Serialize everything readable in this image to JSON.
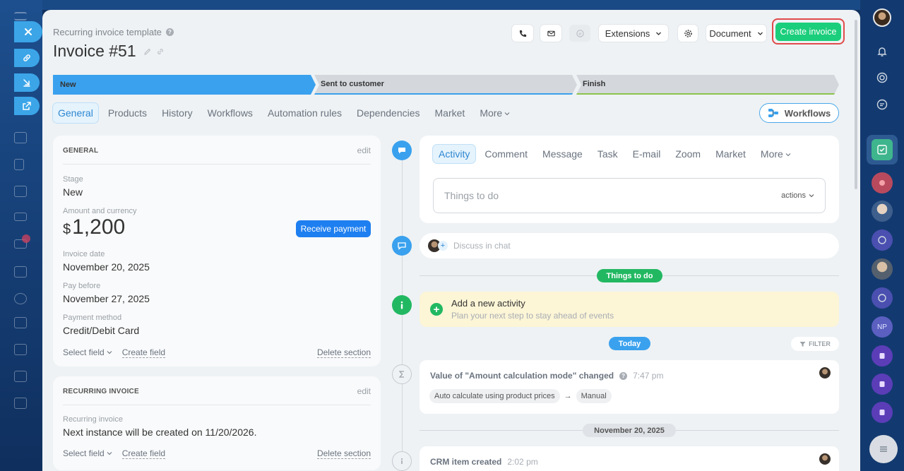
{
  "header": {
    "subtitle": "Recurring invoice template",
    "title": "Invoice #51",
    "extensions_label": "Extensions",
    "document_label": "Document",
    "create_invoice_label": "Create invoice"
  },
  "stages": [
    {
      "label": "New",
      "color": "#3aa1ee"
    },
    {
      "label": "Sent to customer",
      "color": "#d4d8dd"
    },
    {
      "label": "Finish",
      "color": "#d4d8dd"
    }
  ],
  "tabs": [
    "General",
    "Products",
    "History",
    "Workflows",
    "Automation rules",
    "Dependencies",
    "Market",
    "More"
  ],
  "workflows_button": "Workflows",
  "general_section": {
    "heading": "GENERAL",
    "edit": "edit",
    "stage_label": "Stage",
    "stage_value": "New",
    "amount_label": "Amount and currency",
    "currency_symbol": "$",
    "amount_value": "1,200",
    "receive_payment": "Receive payment",
    "invoice_date_label": "Invoice date",
    "invoice_date_value": "November 20, 2025",
    "pay_before_label": "Pay before",
    "pay_before_value": "November 27, 2025",
    "payment_method_label": "Payment method",
    "payment_method_value": "Credit/Debit Card",
    "select_field": "Select field",
    "create_field": "Create field",
    "delete_section": "Delete section"
  },
  "recurring_section": {
    "heading": "RECURRING INVOICE",
    "edit": "edit",
    "label": "Recurring invoice",
    "value": "Next instance will be created on 11/20/2026.",
    "select_field": "Select field",
    "create_field": "Create field",
    "delete_section": "Delete section"
  },
  "activity": {
    "tabs": [
      "Activity",
      "Comment",
      "Message",
      "Task",
      "E-mail",
      "Zoom",
      "Market",
      "More"
    ],
    "input_placeholder": "Things to do",
    "actions_label": "actions"
  },
  "chat": {
    "placeholder": "Discuss in chat"
  },
  "timeline": {
    "things_to_do_pill": "Things to do",
    "add_activity_title": "Add a new activity",
    "add_activity_subtitle": "Plan your next step to stay ahead of events",
    "today_pill": "Today",
    "filter_label": "FILTER",
    "event1": {
      "title": "Value of \"Amount calculation mode\" changed",
      "time": "7:47 pm",
      "from": "Auto calculate using product prices",
      "arrow": "→",
      "to": "Manual"
    },
    "date_pill": "November 20, 2025",
    "event2": {
      "title": "CRM item created",
      "time": "2:02 pm"
    }
  },
  "colors": {
    "accent_blue": "#3aa1ee",
    "create_green": "#1bce7b",
    "highlight_red": "#e04b4b",
    "todo_green": "#22b862"
  }
}
